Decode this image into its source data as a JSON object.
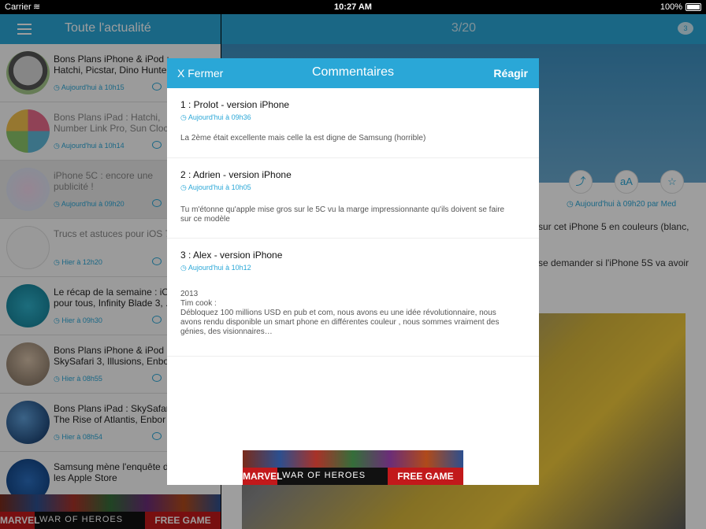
{
  "status": {
    "carrier": "Carrier",
    "time": "10:27 AM",
    "battery": "100%"
  },
  "left": {
    "title": "Toute l'actualité",
    "items": [
      {
        "title": "Bons Plans iPhone & iPod :\nHatchi, Picstar, Dino Hunter",
        "date": "Aujourd'hui à 10h15"
      },
      {
        "title": "Bons Plans iPad : Hatchi,\nNumber Link Pro, Sun Clock",
        "date": "Aujourd'hui à 10h14"
      },
      {
        "title": "iPhone 5C : encore une\npublicité !",
        "date": "Aujourd'hui à 09h20"
      },
      {
        "title": "Trucs et astuces pour iOS 7",
        "date": "Hier à 12h20"
      },
      {
        "title": "Le récap de la semaine : iOS 7\npour tous, Infinity Blade 3, ...",
        "date": "Hier à 09h30"
      },
      {
        "title": "Bons Plans iPhone & iPod :\nSkySafari 3, Illusions, Enbor",
        "date": "Hier à 08h55"
      },
      {
        "title": "Bons Plans iPad : SkySafari 3,\nThe Rise of Atlantis, Enbor",
        "date": "Hier à 08h54"
      },
      {
        "title": "Samsung mène l'enquête dans\nles Apple Store",
        "date": ""
      }
    ]
  },
  "ad": {
    "logo": "MARVEL",
    "text": "WAR OF HEROES",
    "cta": "FREE GAME"
  },
  "right": {
    "counter": "3/20",
    "comment_count": "3",
    "byline": "Aujourd'hui à 09h20 par Med",
    "text1": "sur cet iPhone 5 en couleurs (blanc,",
    "text2": "se demander si l'iPhone 5S va avoir"
  },
  "modal": {
    "close": "X Fermer",
    "title": "Commentaires",
    "react": "Réagir",
    "comments": [
      {
        "author": "1 : Prolot - version iPhone",
        "date": "Aujourd'hui à 09h36",
        "body": "La 2ème était excellente mais celle la est digne de Samsung (horrible)"
      },
      {
        "author": "2 : Adrien  - version iPhone",
        "date": "Aujourd'hui à 10h05",
        "body": "Tu m'étonne qu'apple mise gros sur le 5C vu la marge impressionnante qu'ils doivent se faire\nsur ce modèle"
      },
      {
        "author": "3 : Alex - version iPhone",
        "date": "Aujourd'hui à 10h12",
        "body": "2013\n Tim cook :\nDébloquez 100 millions USD en pub et com, nous avons eu une idée révolutionnaire, nous\navons rendu disponible un smart phone en différentes couleur , nous sommes vraiment des\ngénies, des visionnaires…"
      }
    ]
  }
}
